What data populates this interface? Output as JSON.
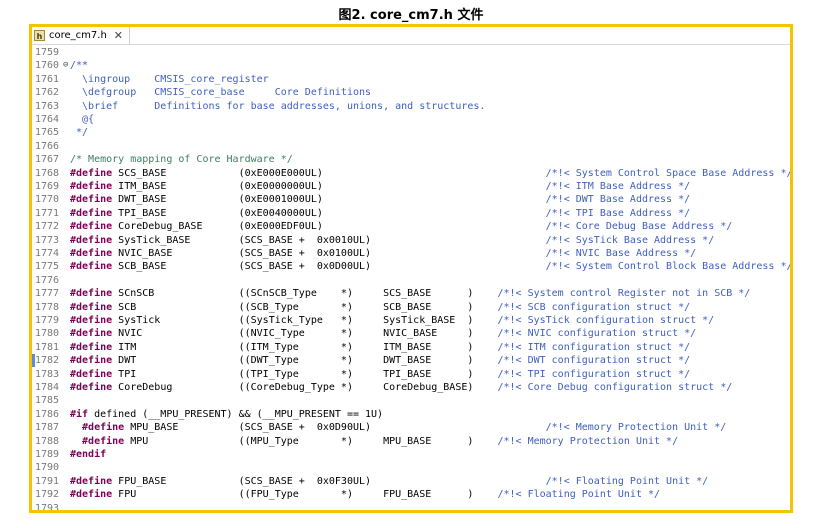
{
  "caption": "图2. core_cm7.h 文件",
  "tab": {
    "label": "core_cm7.h",
    "icon": "header-file-icon"
  },
  "colors": {
    "border": "#f5c400",
    "keyword": "#7f0055",
    "comment": "#3f7f5f",
    "doc_comment": "#3f5fbf",
    "line_number": "#787878"
  },
  "lines": [
    {
      "num": "1759",
      "segs": []
    },
    {
      "num": "1760",
      "fold": "⊖",
      "segs": [
        {
          "t": "/**",
          "c": "dc"
        }
      ]
    },
    {
      "num": "1761",
      "segs": [
        {
          "t": "  \\ingroup    CMSIS_core_register",
          "c": "dc"
        }
      ]
    },
    {
      "num": "1762",
      "segs": [
        {
          "t": "  \\defgroup   CMSIS_core_base     Core Definitions",
          "c": "dc"
        }
      ]
    },
    {
      "num": "1763",
      "segs": [
        {
          "t": "  \\brief      Definitions for base addresses, unions, and structures.",
          "c": "dc"
        }
      ]
    },
    {
      "num": "1764",
      "segs": [
        {
          "t": "  @{",
          "c": "dc"
        }
      ]
    },
    {
      "num": "1765",
      "segs": [
        {
          "t": " */",
          "c": "dc"
        }
      ]
    },
    {
      "num": "1766",
      "segs": []
    },
    {
      "num": "1767",
      "segs": [
        {
          "t": "/* Memory mapping of Core Hardware */",
          "c": "cm"
        }
      ]
    },
    {
      "num": "1768",
      "segs": [
        {
          "t": "#define",
          "c": "kw"
        },
        {
          "t": " SCS_BASE            (0xE000E000UL)                                     ",
          "c": "tx"
        },
        {
          "t": "/*!< System Control Space Base Address */",
          "c": "dc"
        }
      ]
    },
    {
      "num": "1769",
      "segs": [
        {
          "t": "#define",
          "c": "kw"
        },
        {
          "t": " ITM_BASE            (0xE0000000UL)                                     ",
          "c": "tx"
        },
        {
          "t": "/*!< ITM Base Address */",
          "c": "dc"
        }
      ]
    },
    {
      "num": "1770",
      "segs": [
        {
          "t": "#define",
          "c": "kw"
        },
        {
          "t": " DWT_BASE            (0xE0001000UL)                                     ",
          "c": "tx"
        },
        {
          "t": "/*!< DWT Base Address */",
          "c": "dc"
        }
      ]
    },
    {
      "num": "1771",
      "segs": [
        {
          "t": "#define",
          "c": "kw"
        },
        {
          "t": " TPI_BASE            (0xE0040000UL)                                     ",
          "c": "tx"
        },
        {
          "t": "/*!< TPI Base Address */",
          "c": "dc"
        }
      ]
    },
    {
      "num": "1772",
      "segs": [
        {
          "t": "#define",
          "c": "kw"
        },
        {
          "t": " CoreDebug_BASE      (0xE000EDF0UL)                                     ",
          "c": "tx"
        },
        {
          "t": "/*!< Core Debug Base Address */",
          "c": "dc"
        }
      ]
    },
    {
      "num": "1773",
      "segs": [
        {
          "t": "#define",
          "c": "kw"
        },
        {
          "t": " SysTick_BASE        (SCS_BASE +  0x0010UL)                             ",
          "c": "tx"
        },
        {
          "t": "/*!< SysTick Base Address */",
          "c": "dc"
        }
      ]
    },
    {
      "num": "1774",
      "segs": [
        {
          "t": "#define",
          "c": "kw"
        },
        {
          "t": " NVIC_BASE           (SCS_BASE +  0x0100UL)                             ",
          "c": "tx"
        },
        {
          "t": "/*!< NVIC Base Address */",
          "c": "dc"
        }
      ]
    },
    {
      "num": "1775",
      "segs": [
        {
          "t": "#define",
          "c": "kw"
        },
        {
          "t": " SCB_BASE            (SCS_BASE +  0x0D00UL)                             ",
          "c": "tx"
        },
        {
          "t": "/*!< System Control Block Base Address */",
          "c": "dc"
        }
      ]
    },
    {
      "num": "1776",
      "segs": []
    },
    {
      "num": "1777",
      "segs": [
        {
          "t": "#define",
          "c": "kw"
        },
        {
          "t": " SCnSCB              ((SCnSCB_Type    *)     SCS_BASE      )    ",
          "c": "tx"
        },
        {
          "t": "/*!< System control Register not in SCB */",
          "c": "dc"
        }
      ]
    },
    {
      "num": "1778",
      "segs": [
        {
          "t": "#define",
          "c": "kw"
        },
        {
          "t": " SCB                 ((SCB_Type       *)     SCB_BASE      )    ",
          "c": "tx"
        },
        {
          "t": "/*!< SCB configuration struct */",
          "c": "dc"
        }
      ]
    },
    {
      "num": "1779",
      "segs": [
        {
          "t": "#define",
          "c": "kw"
        },
        {
          "t": " SysTick             ((SysTick_Type   *)     SysTick_BASE  )    ",
          "c": "tx"
        },
        {
          "t": "/*!< SysTick configuration struct */",
          "c": "dc"
        }
      ]
    },
    {
      "num": "1780",
      "segs": [
        {
          "t": "#define",
          "c": "kw"
        },
        {
          "t": " NVIC                ((NVIC_Type      *)     NVIC_BASE     )    ",
          "c": "tx"
        },
        {
          "t": "/*!< NVIC configuration struct */",
          "c": "dc"
        }
      ]
    },
    {
      "num": "1781",
      "segs": [
        {
          "t": "#define",
          "c": "kw"
        },
        {
          "t": " ITM                 ((ITM_Type       *)     ITM_BASE      )    ",
          "c": "tx"
        },
        {
          "t": "/*!< ITM configuration struct */",
          "c": "dc"
        }
      ]
    },
    {
      "num": "1782",
      "marker": true,
      "segs": [
        {
          "t": "#define",
          "c": "kw"
        },
        {
          "t": " DWT                 ((DWT_Type       *)     DWT_BASE      )    ",
          "c": "tx"
        },
        {
          "t": "/*!< DWT configuration struct */",
          "c": "dc"
        }
      ]
    },
    {
      "num": "1783",
      "segs": [
        {
          "t": "#define",
          "c": "kw"
        },
        {
          "t": " TPI                 ((TPI_Type       *)     TPI_BASE      )    ",
          "c": "tx"
        },
        {
          "t": "/*!< TPI configuration struct */",
          "c": "dc"
        }
      ]
    },
    {
      "num": "1784",
      "segs": [
        {
          "t": "#define",
          "c": "kw"
        },
        {
          "t": " CoreDebug           ((CoreDebug_Type *)     CoreDebug_BASE)    ",
          "c": "tx"
        },
        {
          "t": "/*!< Core Debug configuration struct */",
          "c": "dc"
        }
      ]
    },
    {
      "num": "1785",
      "segs": []
    },
    {
      "num": "1786",
      "segs": [
        {
          "t": "#if",
          "c": "kw"
        },
        {
          "t": " defined (__MPU_PRESENT) && (__MPU_PRESENT == 1U)",
          "c": "tx"
        }
      ]
    },
    {
      "num": "1787",
      "segs": [
        {
          "t": "  #define",
          "c": "kw"
        },
        {
          "t": " MPU_BASE          (SCS_BASE +  0x0D90UL)                             ",
          "c": "tx"
        },
        {
          "t": "/*!< Memory Protection Unit */",
          "c": "dc"
        }
      ]
    },
    {
      "num": "1788",
      "segs": [
        {
          "t": "  #define",
          "c": "kw"
        },
        {
          "t": " MPU               ((MPU_Type       *)     MPU_BASE      )    ",
          "c": "tx"
        },
        {
          "t": "/*!< Memory Protection Unit */",
          "c": "dc"
        }
      ]
    },
    {
      "num": "1789",
      "segs": [
        {
          "t": "#endif",
          "c": "kw"
        }
      ]
    },
    {
      "num": "1790",
      "segs": []
    },
    {
      "num": "1791",
      "segs": [
        {
          "t": "#define",
          "c": "kw"
        },
        {
          "t": " FPU_BASE            (SCS_BASE +  0x0F30UL)                             ",
          "c": "tx"
        },
        {
          "t": "/*!< Floating Point Unit */",
          "c": "dc"
        }
      ]
    },
    {
      "num": "1792",
      "segs": [
        {
          "t": "#define",
          "c": "kw"
        },
        {
          "t": " FPU                 ((FPU_Type       *)     FPU_BASE      )    ",
          "c": "tx"
        },
        {
          "t": "/*!< Floating Point Unit */",
          "c": "dc"
        }
      ]
    },
    {
      "num": "1793",
      "segs": []
    }
  ]
}
